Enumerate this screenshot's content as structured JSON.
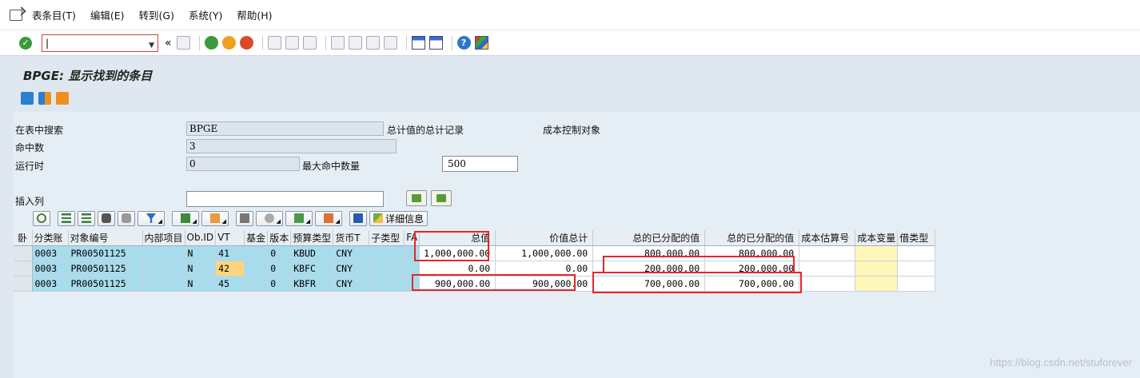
{
  "menu": [
    "表条目(T)",
    "编辑(E)",
    "转到(G)",
    "系统(Y)",
    "帮助(H)"
  ],
  "toolbar": {
    "command_value": "|",
    "back_label": "«"
  },
  "page_title": "BPGE: 显示找到的条目",
  "form": {
    "search_in_table_label": "在表中搜索",
    "search_in_table_value": "BPGE",
    "table_description": "总计值的总计记录",
    "object_description": "成本控制对象",
    "hits_label": "命中数",
    "hits_value": "3",
    "runtime_label": "运行时",
    "runtime_value": "0",
    "max_hits_label": "最大命中数量",
    "max_hits_value": "500",
    "insert_column_label": "插入列",
    "insert_column_value": ""
  },
  "alv": {
    "detail_label": "详细信息"
  },
  "grid": {
    "columns": [
      "分类账",
      "对象编号",
      "内部项目",
      "Ob.ID",
      "VT",
      "基金",
      "版本",
      "预算类型",
      "货币T",
      "子类型",
      "FA",
      "总值",
      "价值总计",
      "总的已分配的值",
      "总的已分配的值",
      "成本估算号",
      "成本变量",
      "借类型"
    ],
    "rows": [
      [
        "0003",
        "PR00501125",
        "",
        "N",
        "41",
        "",
        "0",
        "KBUD",
        "CNY",
        "",
        "",
        "1,000,000.00",
        "1,000,000.00",
        "800,000.00",
        "800,000.00",
        "",
        "",
        ""
      ],
      [
        "0003",
        "PR00501125",
        "",
        "N",
        "42",
        "",
        "0",
        "KBFC",
        "CNY",
        "",
        "",
        "0.00",
        "0.00",
        "200,000.00",
        "200,000.00",
        "",
        "",
        ""
      ],
      [
        "0003",
        "PR00501125",
        "",
        "N",
        "45",
        "",
        "0",
        "KBFR",
        "CNY",
        "",
        "",
        "900,000.00",
        "900,000.00",
        "700,000.00",
        "700,000.00",
        "",
        "",
        ""
      ]
    ]
  },
  "watermark": "https://blog.csdn.net/stuforever",
  "colors": {
    "highlight": "#e5262b",
    "key_cell": "#a7dcec",
    "yellow_cell": "#fef7b8",
    "orange_cell": "#fbd67c"
  }
}
